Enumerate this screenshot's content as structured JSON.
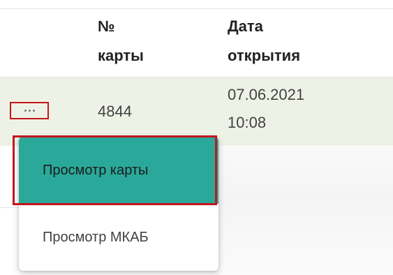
{
  "table": {
    "headers": [
      {
        "line1": "№",
        "line2": "карты"
      },
      {
        "line1": "Дата",
        "line2": "открытия"
      }
    ],
    "rows": [
      {
        "card_number": "4844",
        "open_date": "07.06.2021",
        "open_time": "10:08"
      }
    ]
  },
  "row_actions": {
    "icon": "more-horizontal-icon"
  },
  "context_menu": {
    "items": [
      {
        "label": "Просмотр карты"
      },
      {
        "label": "Просмотр МКАБ"
      }
    ]
  },
  "colors": {
    "row_background": "#eef2e6",
    "menu_active": "#2aa99a",
    "highlight_border": "#c4161c"
  }
}
